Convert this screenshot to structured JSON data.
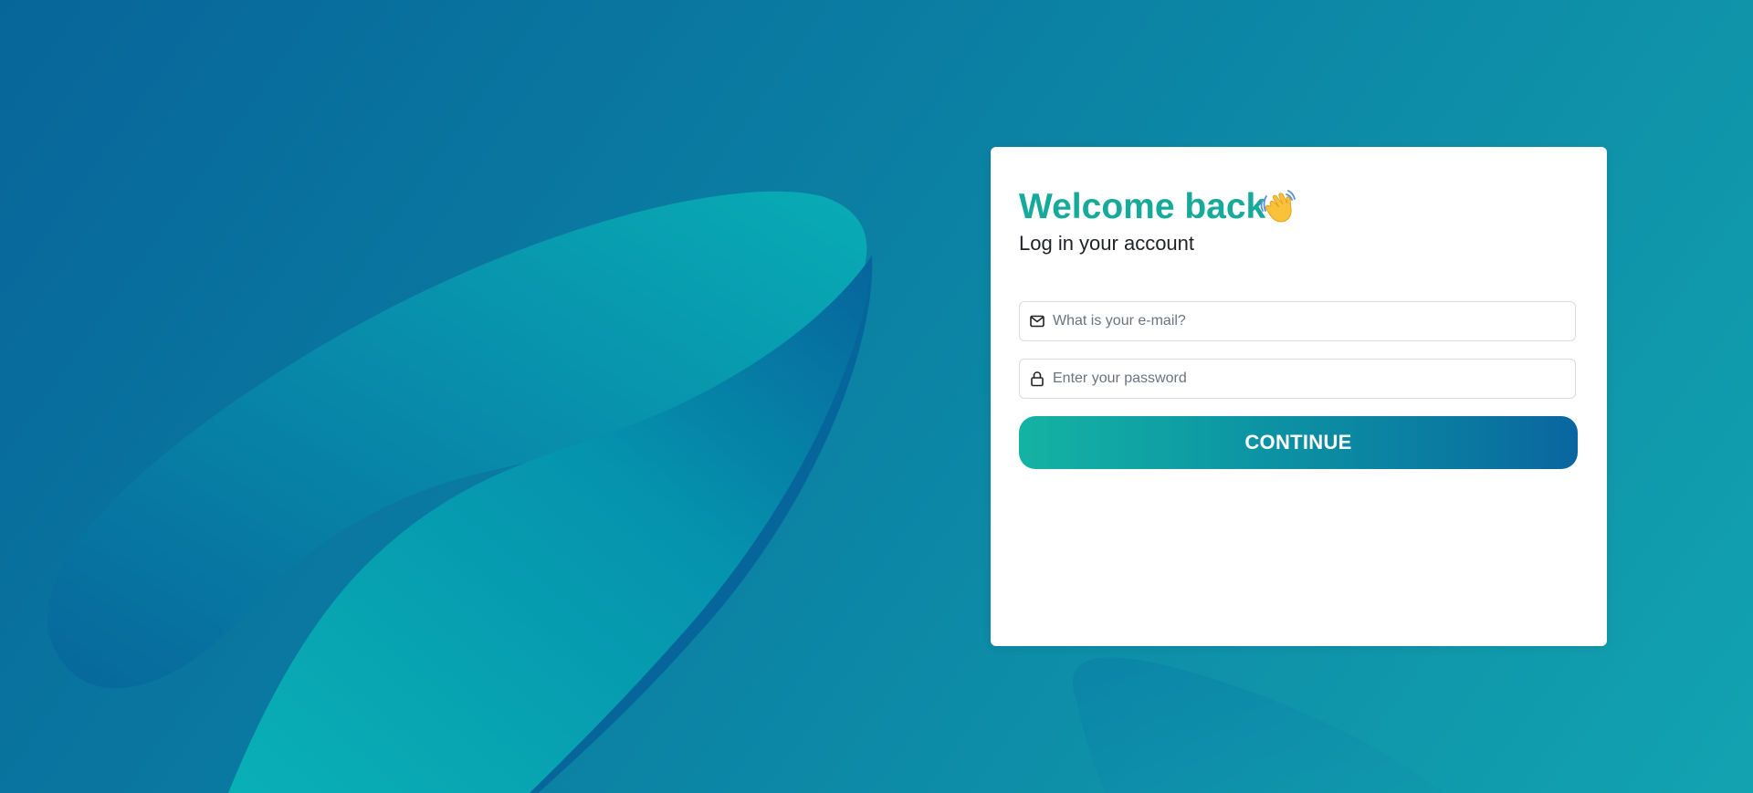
{
  "login": {
    "title": "Welcome back",
    "title_icon": "waving-hand-icon",
    "subtitle": "Log in your account",
    "email": {
      "placeholder": "What is your e-mail?",
      "value": "",
      "icon": "mail-icon"
    },
    "password": {
      "placeholder": "Enter your password",
      "value": "",
      "icon": "lock-icon"
    },
    "continue_label": "CONTINUE"
  },
  "colors": {
    "accent": "#17aa9b",
    "button_start": "#14b3a3",
    "button_end": "#0a66a0",
    "background_start": "#07659a",
    "background_end": "#12a3b0"
  }
}
